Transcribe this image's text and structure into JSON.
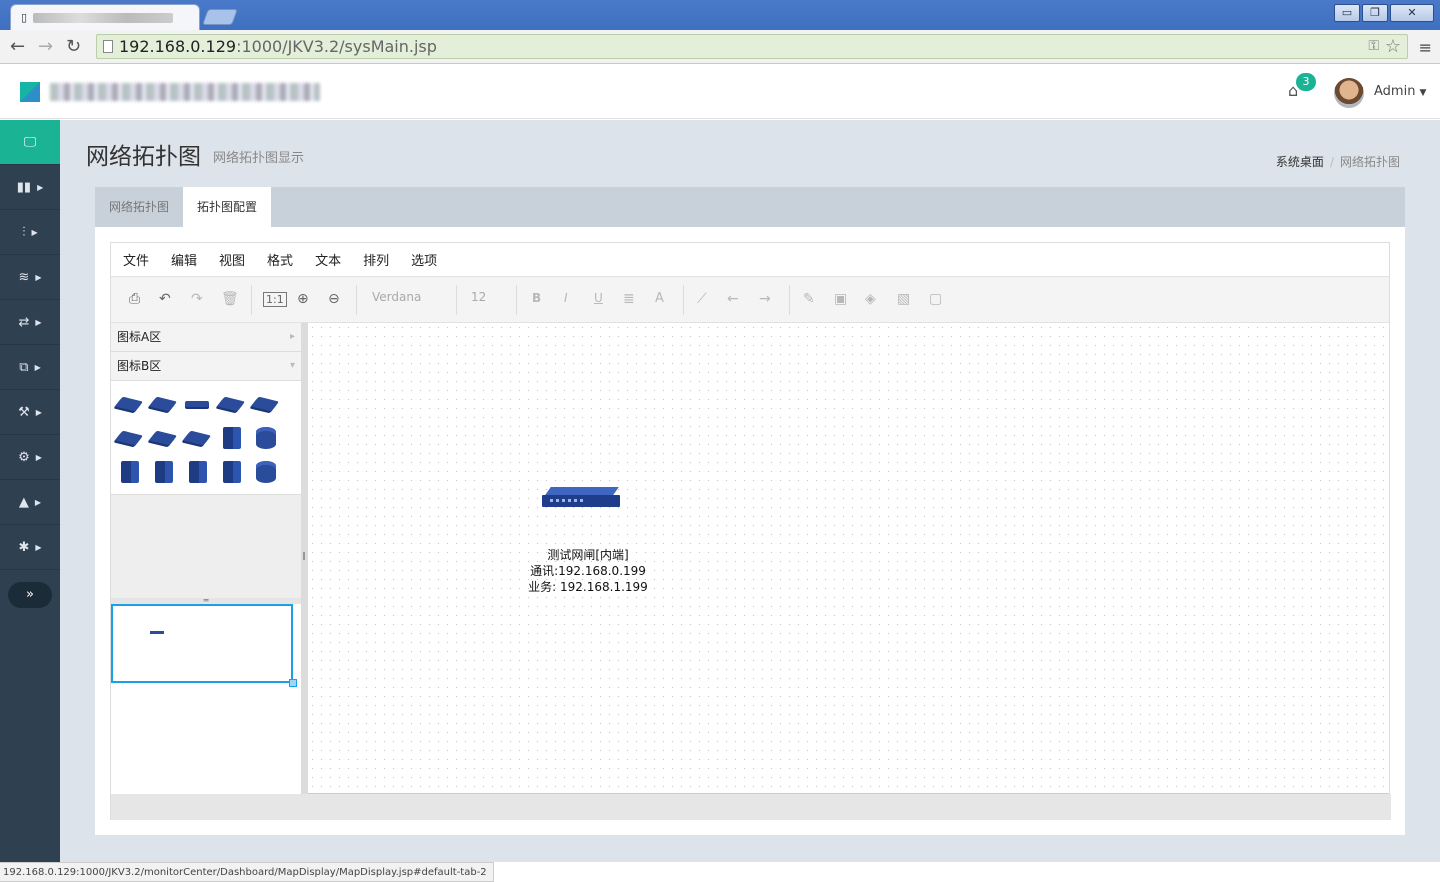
{
  "browser": {
    "url_host": "192.168.0.129",
    "url_rest": ":1000/JKV3.2/sysMain.jsp",
    "status_url": "192.168.0.129:1000/JKV3.2/monitorCenter/Dashboard/MapDisplay/MapDisplay.jsp#default-tab-2",
    "win_min": "▭",
    "win_restore": "❐",
    "win_close": "✕"
  },
  "header": {
    "notification_count": "3",
    "user_name": "Admin"
  },
  "sidebar": {
    "items": [
      {
        "icon": "monitor-icon",
        "glyph": "🖵"
      },
      {
        "icon": "briefcase-icon",
        "glyph": "▮▮"
      },
      {
        "icon": "sliders-icon",
        "glyph": "⫶"
      },
      {
        "icon": "database-icon",
        "glyph": "≋"
      },
      {
        "icon": "exchange-icon",
        "glyph": "⇄"
      },
      {
        "icon": "clipboard-icon",
        "glyph": "⧉"
      },
      {
        "icon": "tools-icon",
        "glyph": "⚒"
      },
      {
        "icon": "cogs-icon",
        "glyph": "⚙"
      },
      {
        "icon": "warning-icon",
        "glyph": "▲"
      },
      {
        "icon": "gear-icon",
        "glyph": "✱"
      }
    ],
    "toggle_glyph": "»"
  },
  "page": {
    "title": "网络拓扑图",
    "subtitle": "网络拓扑图显示",
    "breadcrumb": [
      "系统桌面",
      "网络拓扑图"
    ]
  },
  "tabs": [
    "网络拓扑图",
    "拓扑图配置"
  ],
  "editor": {
    "menu": [
      "文件",
      "编辑",
      "视图",
      "格式",
      "文本",
      "排列",
      "选项"
    ],
    "font_name": "Verdana",
    "font_size": "12",
    "sections": [
      "图标A区",
      "图标B区"
    ],
    "node_label": [
      "测试网闸[内端]",
      "通讯:192.168.0.199",
      "业务: 192.168.1.199"
    ]
  },
  "colors": {
    "accent": "#1ab394",
    "sidebar": "#2f4050",
    "device": "#2a4c9a",
    "outline": "#1aa0e6"
  }
}
